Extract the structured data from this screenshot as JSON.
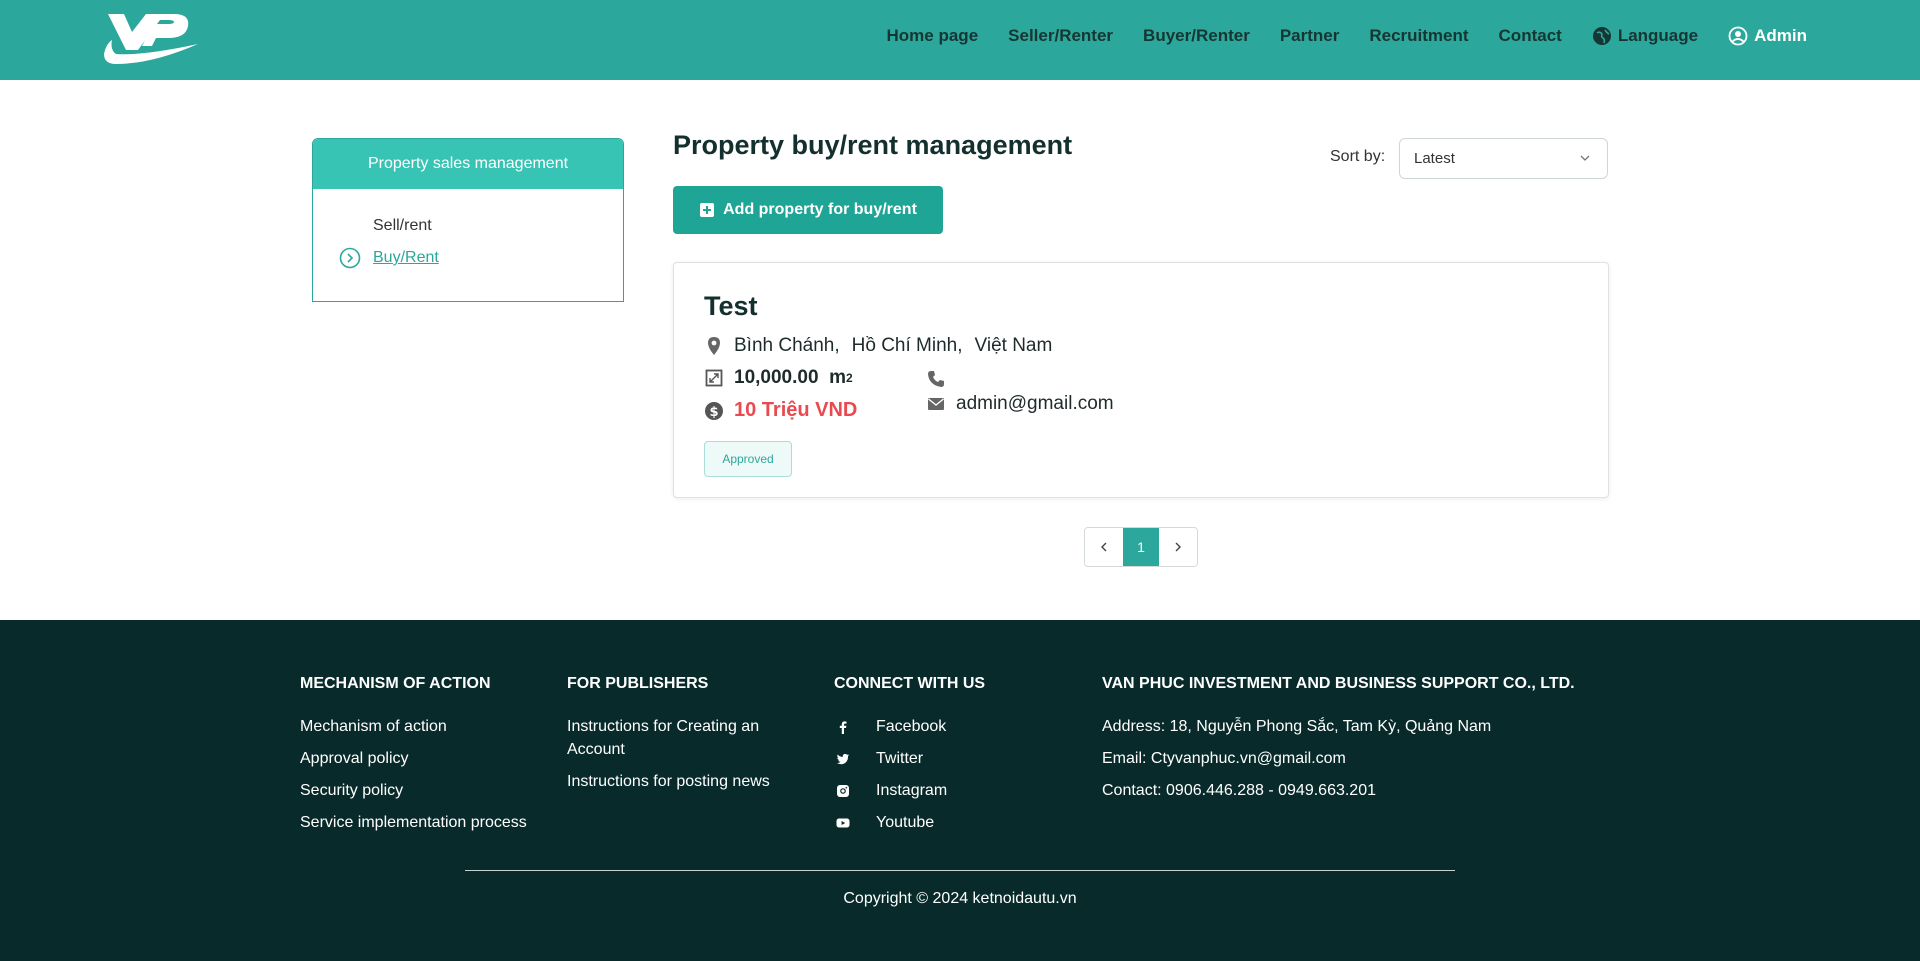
{
  "brand": {
    "logo_alt": "VP logo",
    "color_primary": "#2ca79b",
    "color_footer": "#082a2a",
    "color_price": "#e84a4f"
  },
  "nav": {
    "items": [
      "Home page",
      "Seller/Renter",
      "Buyer/Renter",
      "Partner",
      "Recruitment",
      "Contact"
    ],
    "language_label": "Language",
    "admin_label": "Admin"
  },
  "sidebar": {
    "title": "Property sales management",
    "items": [
      "Sell/rent",
      "Buy/Rent"
    ]
  },
  "main": {
    "title": "Property buy/rent management",
    "sort_label": "Sort by:",
    "sort_value": "Latest",
    "add_button": "Add property for buy/rent"
  },
  "listing": {
    "title": "Test",
    "location": [
      "Bình Chánh,",
      "Hồ Chí Minh,",
      "Việt Nam"
    ],
    "area": "10,000.00",
    "area_unit": "m",
    "area_unit_sup": "2",
    "price": "10 Triệu VND",
    "phone": "",
    "email": "admin@gmail.com",
    "status": "Approved"
  },
  "pagination": {
    "current": "1"
  },
  "footer": {
    "col1": {
      "title": "MECHANISM OF ACTION",
      "items": [
        "Mechanism of action",
        "Approval policy",
        "Security policy",
        "Service implementation process"
      ]
    },
    "col2": {
      "title": "FOR PUBLISHERS",
      "items": [
        "Instructions for Creating an Account",
        "Instructions for posting news"
      ]
    },
    "col3": {
      "title": "CONNECT WITH US",
      "items": [
        "Facebook",
        "Twitter",
        "Instagram",
        "Youtube"
      ]
    },
    "col4": {
      "title": "VAN PHUC INVESTMENT AND BUSINESS SUPPORT CO., LTD.",
      "items": [
        "Address: 18, Nguyễn Phong Sắc, Tam Kỳ, Quảng Nam",
        "Email: Ctyvanphuc.vn@gmail.com",
        "Contact: 0906.446.288 - 0949.663.201"
      ]
    },
    "copyright": "Copyright © 2024 ketnoidautu.vn"
  }
}
